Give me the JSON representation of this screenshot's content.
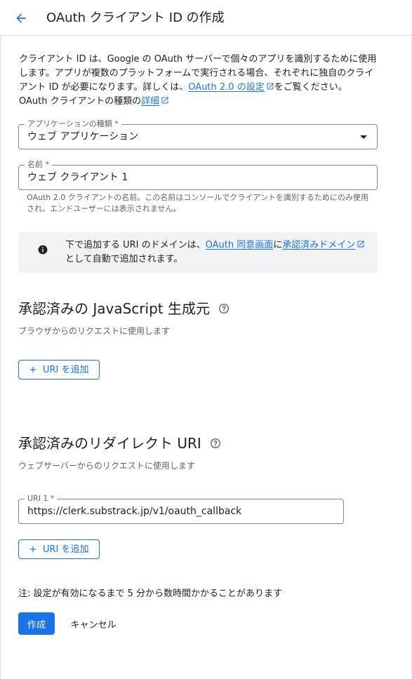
{
  "header": {
    "back_icon": "arrow-back-icon",
    "title": "OAuth クライアント ID の作成"
  },
  "intro": {
    "text_1": "クライアント ID は、Google の OAuth サーバーで個々のアプリを識別するために使用します。アプリが複数のプラットフォームで実行される場合、それぞれに独自のクライアント ID が必要になります。詳しくは、",
    "link_1": "OAuth 2.0 の設定",
    "text_2": "をご覧ください。 OAuth クライアントの種類の",
    "link_2": "詳細"
  },
  "app_type": {
    "label": "アプリケーションの種類 *",
    "value": "ウェブ アプリケーション"
  },
  "name_field": {
    "label": "名前 *",
    "value": "ウェブ クライアント 1",
    "helper": "OAuth 2.0 クライアントの名前。この名前はコンソールでクライアントを識別するためにのみ使用され、エンドユーザーには表示されません。"
  },
  "info": {
    "text_1": "下で追加する URI のドメインは、",
    "link_1": "OAuth 同意画面",
    "text_2": "に",
    "link_2": "承認済みドメイン",
    "text_3": "として自動で追加されます。"
  },
  "js_origins": {
    "title": "承認済みの JavaScript 生成元",
    "subtitle": "ブラウザからのリクエストに使用します",
    "add_label": "URI を追加"
  },
  "redirect_uris": {
    "title": "承認済みのリダイレクト URI",
    "subtitle": "ウェブサーバーからのリクエストに使用します",
    "uri_label": "URI 1 *",
    "uri_value": "https://clerk.substrack.jp/v1/oauth_callback",
    "add_label": "URI を追加"
  },
  "footer": {
    "note": "注: 設定が有効になるまで 5 分から数時間かかることがあります",
    "create_label": "作成",
    "cancel_label": "キャンセル"
  },
  "colors": {
    "accent": "#1a73e8",
    "border": "#dadce0",
    "muted_text": "#5f6368",
    "info_bg": "#f1f3f4"
  }
}
